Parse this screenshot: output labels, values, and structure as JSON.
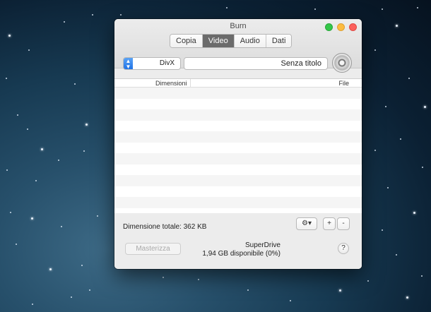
{
  "window": {
    "title": "Burn"
  },
  "tabs": [
    {
      "label": "Copia",
      "active": false
    },
    {
      "label": "Video",
      "active": true
    },
    {
      "label": "Audio",
      "active": false
    },
    {
      "label": "Dati",
      "active": false
    }
  ],
  "toolbar": {
    "format_value": "DivX",
    "title_field_value": "Senza titolo"
  },
  "list": {
    "columns": {
      "size": "Dimensioni",
      "file": "File"
    },
    "rows": []
  },
  "footer": {
    "total_size_label": "Dimensione totale: 362 KB",
    "buttons": {
      "gear_icon": "gear-icon",
      "add": "+",
      "remove": "-"
    },
    "burn_button": "Masterizza",
    "drive_name": "SuperDrive",
    "drive_available": "1,94 GB disponibile (0%)",
    "help_label": "?"
  },
  "colors": {
    "accent": "#1f72e6",
    "selected_tab": "#6b6b6b"
  }
}
